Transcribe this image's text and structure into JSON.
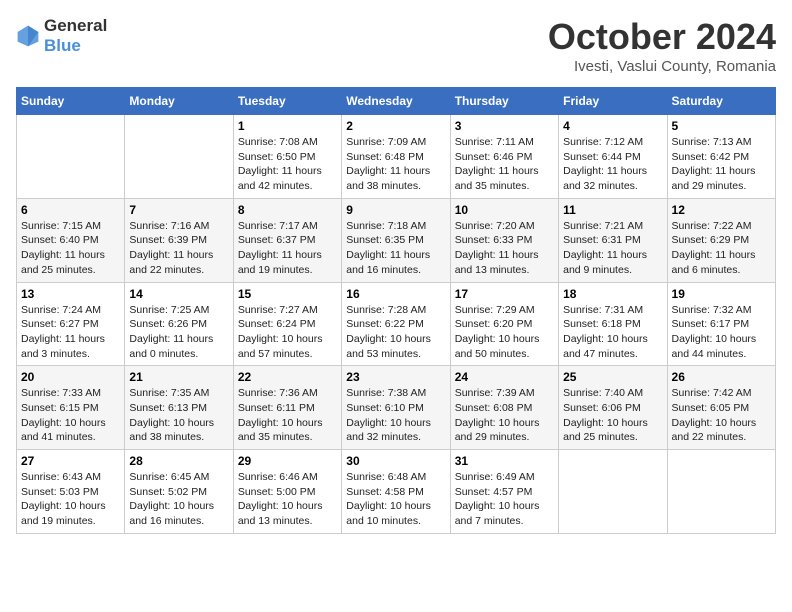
{
  "logo": {
    "general": "General",
    "blue": "Blue"
  },
  "title": "October 2024",
  "location": "Ivesti, Vaslui County, Romania",
  "days_of_week": [
    "Sunday",
    "Monday",
    "Tuesday",
    "Wednesday",
    "Thursday",
    "Friday",
    "Saturday"
  ],
  "weeks": [
    [
      null,
      null,
      {
        "num": "1",
        "sunrise": "7:08 AM",
        "sunset": "6:50 PM",
        "daylight": "11 hours and 42 minutes."
      },
      {
        "num": "2",
        "sunrise": "7:09 AM",
        "sunset": "6:48 PM",
        "daylight": "11 hours and 38 minutes."
      },
      {
        "num": "3",
        "sunrise": "7:11 AM",
        "sunset": "6:46 PM",
        "daylight": "11 hours and 35 minutes."
      },
      {
        "num": "4",
        "sunrise": "7:12 AM",
        "sunset": "6:44 PM",
        "daylight": "11 hours and 32 minutes."
      },
      {
        "num": "5",
        "sunrise": "7:13 AM",
        "sunset": "6:42 PM",
        "daylight": "11 hours and 29 minutes."
      }
    ],
    [
      {
        "num": "6",
        "sunrise": "7:15 AM",
        "sunset": "6:40 PM",
        "daylight": "11 hours and 25 minutes."
      },
      {
        "num": "7",
        "sunrise": "7:16 AM",
        "sunset": "6:39 PM",
        "daylight": "11 hours and 22 minutes."
      },
      {
        "num": "8",
        "sunrise": "7:17 AM",
        "sunset": "6:37 PM",
        "daylight": "11 hours and 19 minutes."
      },
      {
        "num": "9",
        "sunrise": "7:18 AM",
        "sunset": "6:35 PM",
        "daylight": "11 hours and 16 minutes."
      },
      {
        "num": "10",
        "sunrise": "7:20 AM",
        "sunset": "6:33 PM",
        "daylight": "11 hours and 13 minutes."
      },
      {
        "num": "11",
        "sunrise": "7:21 AM",
        "sunset": "6:31 PM",
        "daylight": "11 hours and 9 minutes."
      },
      {
        "num": "12",
        "sunrise": "7:22 AM",
        "sunset": "6:29 PM",
        "daylight": "11 hours and 6 minutes."
      }
    ],
    [
      {
        "num": "13",
        "sunrise": "7:24 AM",
        "sunset": "6:27 PM",
        "daylight": "11 hours and 3 minutes."
      },
      {
        "num": "14",
        "sunrise": "7:25 AM",
        "sunset": "6:26 PM",
        "daylight": "11 hours and 0 minutes."
      },
      {
        "num": "15",
        "sunrise": "7:27 AM",
        "sunset": "6:24 PM",
        "daylight": "10 hours and 57 minutes."
      },
      {
        "num": "16",
        "sunrise": "7:28 AM",
        "sunset": "6:22 PM",
        "daylight": "10 hours and 53 minutes."
      },
      {
        "num": "17",
        "sunrise": "7:29 AM",
        "sunset": "6:20 PM",
        "daylight": "10 hours and 50 minutes."
      },
      {
        "num": "18",
        "sunrise": "7:31 AM",
        "sunset": "6:18 PM",
        "daylight": "10 hours and 47 minutes."
      },
      {
        "num": "19",
        "sunrise": "7:32 AM",
        "sunset": "6:17 PM",
        "daylight": "10 hours and 44 minutes."
      }
    ],
    [
      {
        "num": "20",
        "sunrise": "7:33 AM",
        "sunset": "6:15 PM",
        "daylight": "10 hours and 41 minutes."
      },
      {
        "num": "21",
        "sunrise": "7:35 AM",
        "sunset": "6:13 PM",
        "daylight": "10 hours and 38 minutes."
      },
      {
        "num": "22",
        "sunrise": "7:36 AM",
        "sunset": "6:11 PM",
        "daylight": "10 hours and 35 minutes."
      },
      {
        "num": "23",
        "sunrise": "7:38 AM",
        "sunset": "6:10 PM",
        "daylight": "10 hours and 32 minutes."
      },
      {
        "num": "24",
        "sunrise": "7:39 AM",
        "sunset": "6:08 PM",
        "daylight": "10 hours and 29 minutes."
      },
      {
        "num": "25",
        "sunrise": "7:40 AM",
        "sunset": "6:06 PM",
        "daylight": "10 hours and 25 minutes."
      },
      {
        "num": "26",
        "sunrise": "7:42 AM",
        "sunset": "6:05 PM",
        "daylight": "10 hours and 22 minutes."
      }
    ],
    [
      {
        "num": "27",
        "sunrise": "6:43 AM",
        "sunset": "5:03 PM",
        "daylight": "10 hours and 19 minutes."
      },
      {
        "num": "28",
        "sunrise": "6:45 AM",
        "sunset": "5:02 PM",
        "daylight": "10 hours and 16 minutes."
      },
      {
        "num": "29",
        "sunrise": "6:46 AM",
        "sunset": "5:00 PM",
        "daylight": "10 hours and 13 minutes."
      },
      {
        "num": "30",
        "sunrise": "6:48 AM",
        "sunset": "4:58 PM",
        "daylight": "10 hours and 10 minutes."
      },
      {
        "num": "31",
        "sunrise": "6:49 AM",
        "sunset": "4:57 PM",
        "daylight": "10 hours and 7 minutes."
      },
      null,
      null
    ]
  ]
}
